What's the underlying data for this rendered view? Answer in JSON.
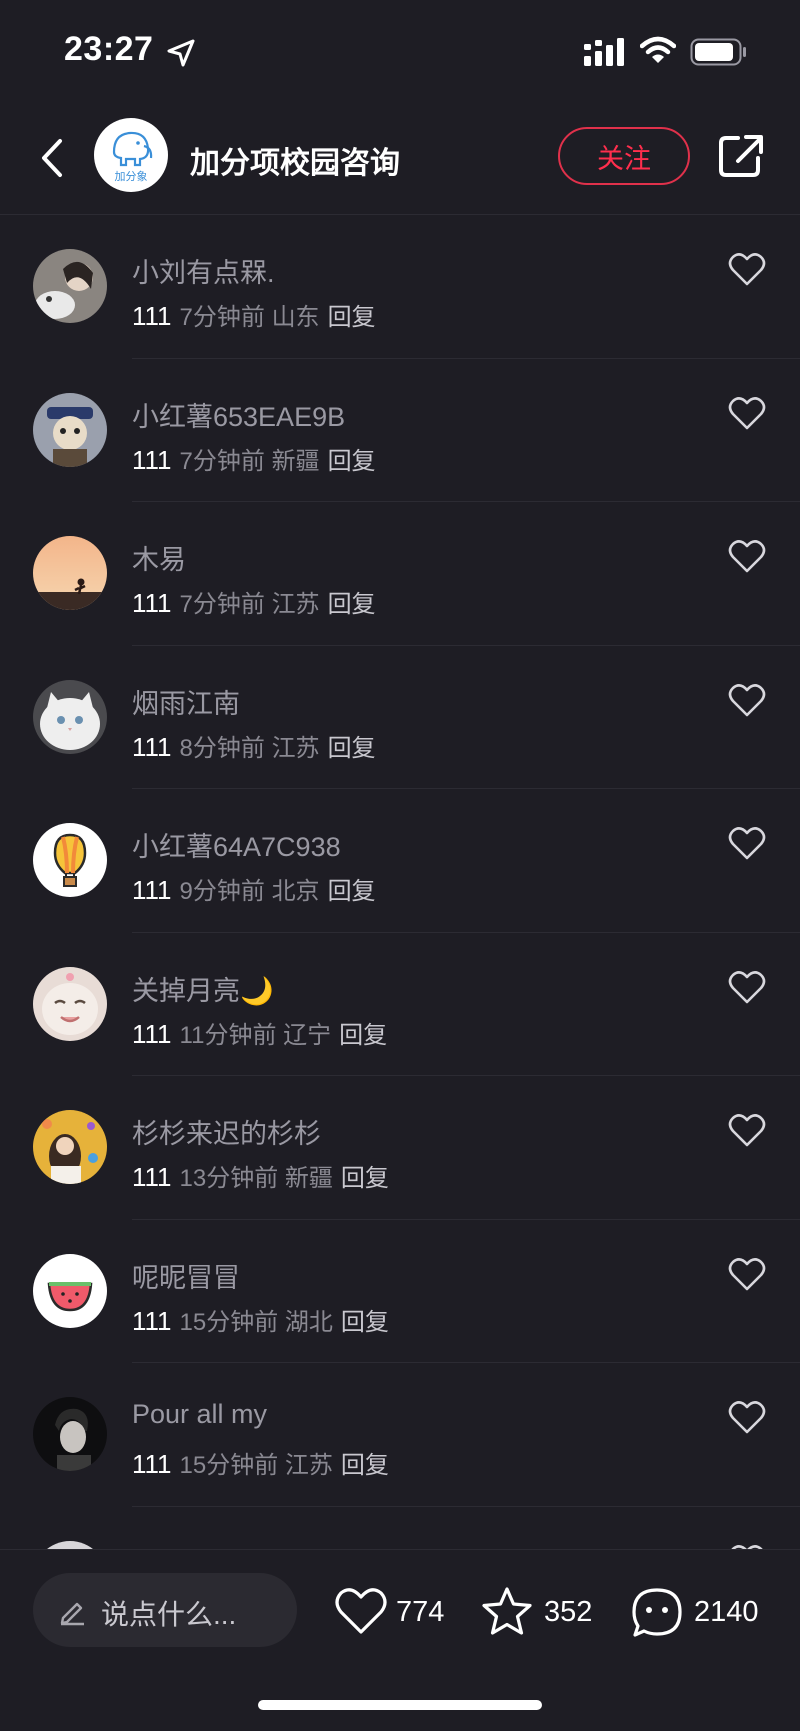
{
  "status_bar": {
    "time": "23:27"
  },
  "header": {
    "logo_text": "加分象",
    "title": "加分项校园咨询",
    "follow_label": "关注"
  },
  "comments": [
    {
      "name": "小刘有点槑.",
      "content": "111",
      "time": "7分钟前",
      "location": "山东",
      "reply": "回复"
    },
    {
      "name": "小红薯653EAE9B",
      "content": "111",
      "time": "7分钟前",
      "location": "新疆",
      "reply": "回复"
    },
    {
      "name": "木易",
      "content": "111",
      "time": "7分钟前",
      "location": "江苏",
      "reply": "回复"
    },
    {
      "name": "烟雨江南",
      "content": "111",
      "time": "8分钟前",
      "location": "江苏",
      "reply": "回复"
    },
    {
      "name": "小红薯64A7C938",
      "content": "111",
      "time": "9分钟前",
      "location": "北京",
      "reply": "回复"
    },
    {
      "name": "关掉月亮🌙",
      "content": "111",
      "time": "11分钟前",
      "location": "辽宁",
      "reply": "回复"
    },
    {
      "name": "杉杉来迟的杉杉",
      "content": "111",
      "time": "13分钟前",
      "location": "新疆",
      "reply": "回复"
    },
    {
      "name": "呢昵冒冒",
      "content": "111",
      "time": "15分钟前",
      "location": "湖北",
      "reply": "回复"
    },
    {
      "name": "Pour all my",
      "content": "111",
      "time": "15分钟前",
      "location": "江苏",
      "reply": "回复"
    }
  ],
  "bottom_bar": {
    "input_placeholder": "说点什么...",
    "likes": "774",
    "favorites": "352",
    "comments": "2140"
  },
  "colors": {
    "background": "#1e1d24",
    "accent": "#ff2e4d"
  }
}
